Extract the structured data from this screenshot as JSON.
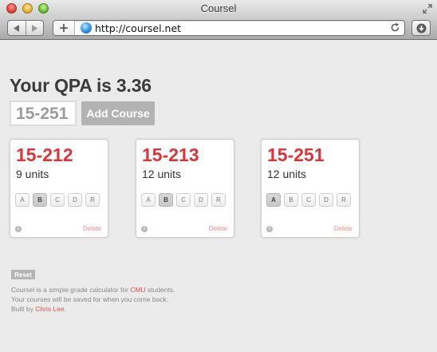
{
  "window": {
    "title": "Coursel",
    "url": "http://coursel.net"
  },
  "icons": {
    "close": "close-window-button",
    "minimize": "minimize-window-button",
    "zoom": "zoom-window-button",
    "fullscreen": "fullscreen-icon",
    "back": "back-arrow-icon",
    "forward": "forward-arrow-icon",
    "add_tab": "plus-icon",
    "site": "globe-icon",
    "reload": "reload-icon",
    "downloads": "download-icon",
    "info": "info-icon"
  },
  "page": {
    "qpa_text": "Your QPA is 3.36",
    "course_input": {
      "value": "15-251",
      "placeholder": ""
    },
    "add_course_label": "Add Course"
  },
  "courses": [
    {
      "code": "15-212",
      "units": "9 units",
      "grades": [
        "A",
        "B",
        "C",
        "D",
        "R"
      ],
      "selected": "B",
      "delete_label": "Delete"
    },
    {
      "code": "15-213",
      "units": "12 units",
      "grades": [
        "A",
        "B",
        "C",
        "D",
        "R"
      ],
      "selected": "B",
      "delete_label": "Delete"
    },
    {
      "code": "15-251",
      "units": "12 units",
      "grades": [
        "A",
        "B",
        "C",
        "D",
        "R"
      ],
      "selected": "A",
      "delete_label": "Delete"
    }
  ],
  "footer": {
    "reset_label": "Reset",
    "line1_before": "Coursel is a simple grade calculator for ",
    "line1_link": "CMU",
    "line1_after": " students.",
    "line2": "Your courses will be saved for when you come back.",
    "line3_before": "Built by ",
    "line3_link": "Chris Lee",
    "line3_after": "."
  },
  "colors": {
    "course_code": "#d9363b",
    "link": "#e05050",
    "delete": "#f08a8a",
    "button_gray": "#b3b3b3",
    "page_background": "#ebebeb"
  }
}
